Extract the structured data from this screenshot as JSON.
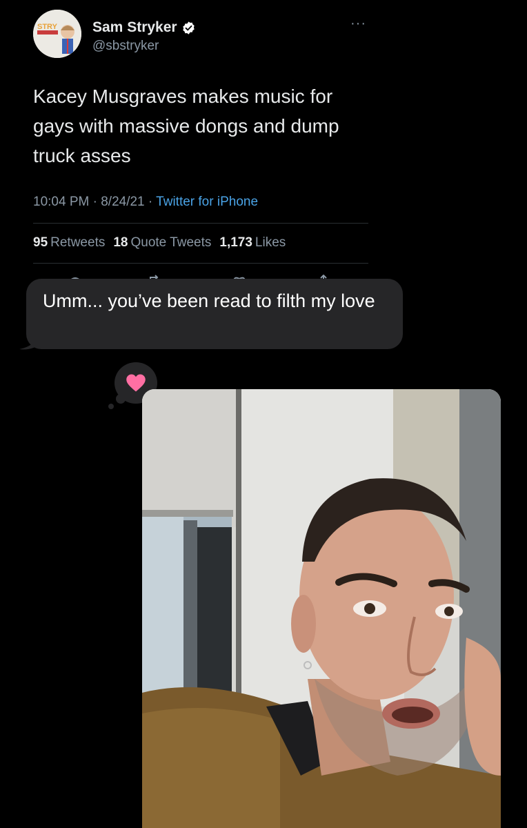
{
  "tweet": {
    "author_name": "Sam Stryker",
    "author_handle": "@sbstryker",
    "avatar_text": "STRY",
    "text": "Kacey Musgraves makes music for gays with massive dongs and dump truck asses",
    "time": "10:04 PM",
    "date": "8/24/21",
    "source": "Twitter for iPhone",
    "stats": {
      "retweets_count": "95",
      "retweets_label": "Retweets",
      "quotes_count": "18",
      "quotes_label": "Quote Tweets",
      "likes_count": "1,173",
      "likes_label": "Likes"
    }
  },
  "message": {
    "text": "Umm... you’ve been read to filth my love",
    "tapback": "heart-icon"
  },
  "colors": {
    "background": "#000000",
    "bubble": "#262628",
    "link": "#4aa3e6",
    "heart": "#ff6fa3",
    "secondary_text": "#8b98a5",
    "verified": "#ffffff"
  }
}
